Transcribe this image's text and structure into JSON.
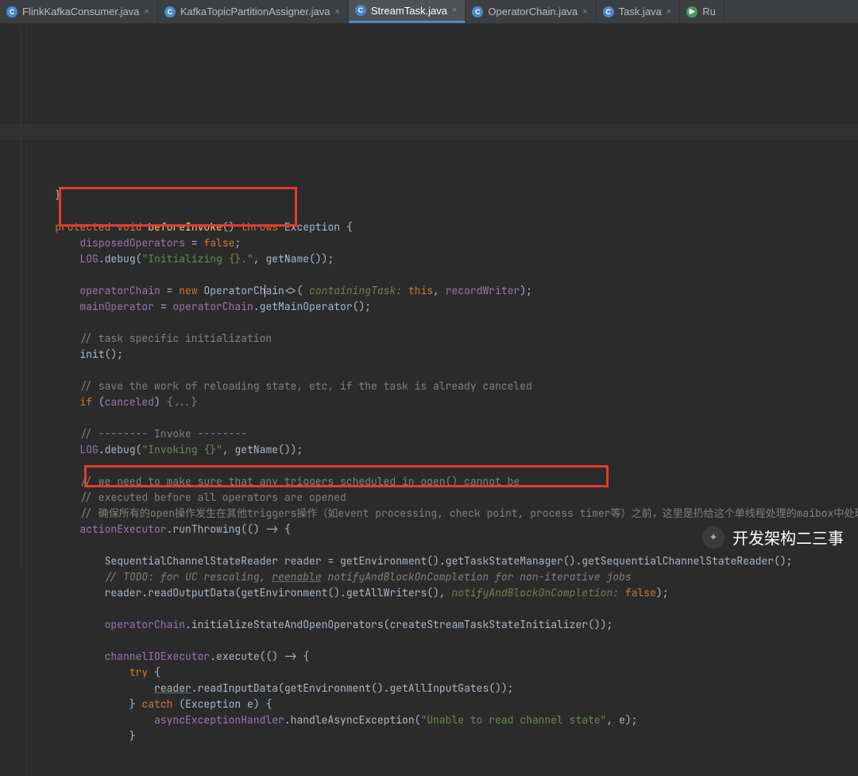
{
  "tabs": [
    {
      "label": "FlinkKafkaConsumer.java",
      "icon": "C",
      "icon_type": "class"
    },
    {
      "label": "KafkaTopicPartitionAssigner.java",
      "icon": "C",
      "icon_type": "class"
    },
    {
      "label": "StreamTask.java",
      "icon": "C",
      "icon_type": "class",
      "active": true
    },
    {
      "label": "OperatorChain.java",
      "icon": "C",
      "icon_type": "class"
    },
    {
      "label": "Task.java",
      "icon": "C",
      "icon_type": "class"
    },
    {
      "label": "Ru",
      "icon": "▶",
      "icon_type": "run"
    }
  ],
  "code": {
    "l1": "}",
    "l2_kw1": "protected",
    "l2_kw2": "void",
    "l2_fn": "beforeInvoke",
    "l2_kw3": "throws",
    "l2_exc": "Exception",
    "l3_var": "disposedOperators",
    "l3_kw": "false",
    "l4_var": "LOG",
    "l4_fn": "debug",
    "l4_str": "\"Initializing {}.\"",
    "l4_call": "getName",
    "l5_var": "operatorChain",
    "l5_kw": "new",
    "l5_type_a": "OperatorCh",
    "l5_type_b": "ain",
    "l5_param": "containingTask:",
    "l5_this": "this",
    "l5_arg": "recordWriter",
    "l6_var": "mainOperator",
    "l6_chain": "operatorChain",
    "l6_fn": "getMainOperator",
    "l7_com": "// task specific initialization",
    "l8_fn": "init",
    "l9_com": "// save the work of reloading state, etc, if the task is already canceled",
    "l10_kw": "if",
    "l10_var": "canceled",
    "l10_fold": "{...}",
    "l11_com": "// -------- Invoke --------",
    "l12_var": "LOG",
    "l12_fn": "debug",
    "l12_str": "\"Invoking {}\"",
    "l12_call": "getName",
    "l13_com": "// we need to make sure that any triggers scheduled in open() cannot be",
    "l14_com": "// executed before all operators are opened",
    "l15_com": "// 确保所有的open操作发生在其他triggers操作（如event processing, check point, process timer等）之前，这里是扔给这个单线程处理的maibox中处理的",
    "l16_var": "actionExecutor",
    "l16_fn": "runThrowing",
    "l17_type": "SequentialChannelStateReader",
    "l17_var": "reader",
    "l17_c1": "getEnvironment",
    "l17_c2": "getTaskStateManager",
    "l17_c3": "getSequentialChannelStateReader",
    "l18_com_a": "// ",
    "l18_todo": "TODO: for UC rescaling, ",
    "l18_reen": "reenable",
    "l18_rest": " notifyAndBlockOnCompletion for non-iterative jobs",
    "l19_var": "reader",
    "l19_fn": "readOutputData",
    "l19_c1": "getEnvironment",
    "l19_c2": "getAllWriters",
    "l19_param": "notifyAndBlockOnCompletion:",
    "l19_kw": "false",
    "l20_var": "operatorChain",
    "l20_fn": "initializeStateAndOpenOperators",
    "l20_arg": "createStreamTaskStateInitializer",
    "l21_var": "channelIOExecutor",
    "l21_fn": "execute",
    "l22_kw": "try",
    "l23_var": "reader",
    "l23_fn": "readInputData",
    "l23_c1": "getEnvironment",
    "l23_c2": "getAllInputGates",
    "l24_kw": "catch",
    "l24_type": "Exception",
    "l24_var": "e",
    "l25_var": "asyncExceptionHandler",
    "l25_fn": "handleAsyncException",
    "l25_str": "\"Unable to read channel state\"",
    "l25_arg": "e",
    "l26": "}"
  },
  "watermark": {
    "text": "开发架构二三事",
    "icon": "✦"
  }
}
